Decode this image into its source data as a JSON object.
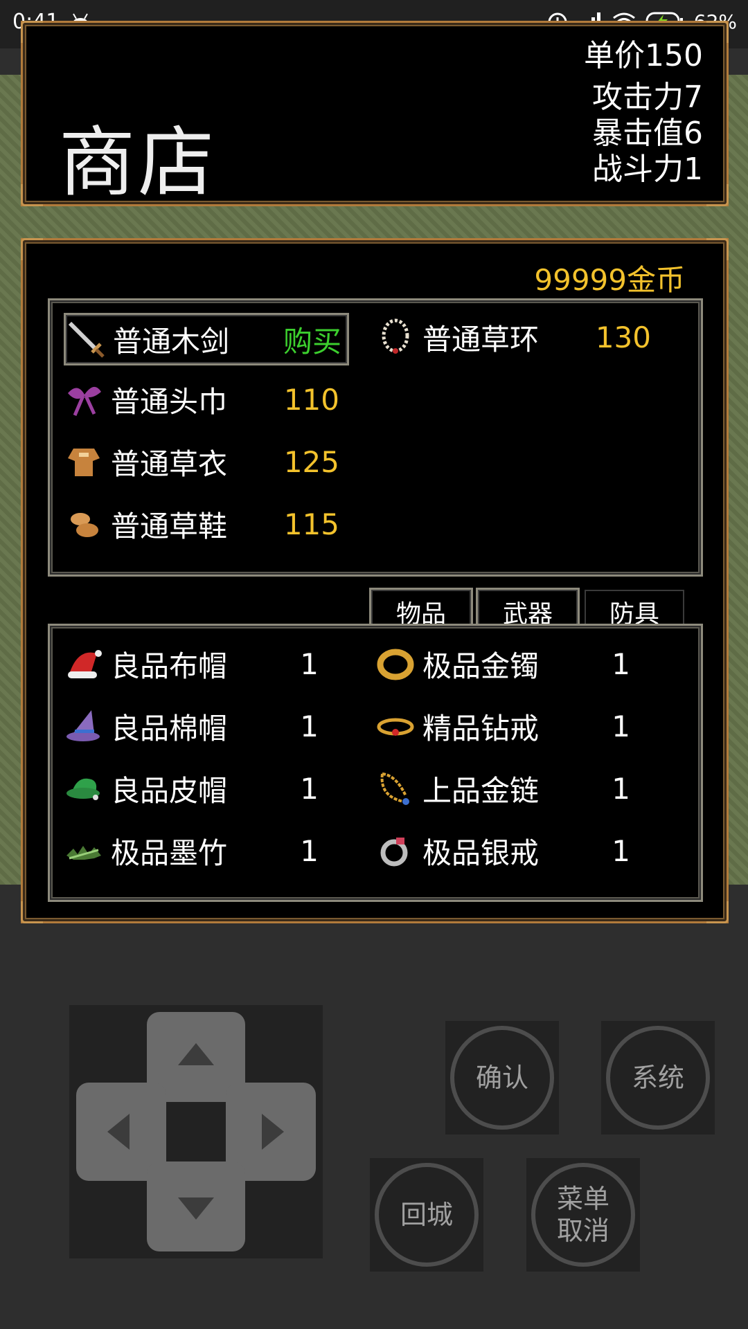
{
  "status_bar": {
    "time": "0:41",
    "battery": "62%"
  },
  "header": {
    "title": "商店",
    "unit_price": "单价150",
    "attack": "攻击力7",
    "crit": "暴击值6",
    "power": "战斗力1"
  },
  "gold": "99999金币",
  "shop_items": [
    {
      "name": "普通木剑",
      "price": "购买",
      "icon": "sword-icon",
      "buy": true
    },
    {
      "name": "普通草环",
      "price": "130",
      "icon": "necklace-icon"
    },
    {
      "name": "普通头巾",
      "price": "110",
      "icon": "ribbon-icon"
    },
    {
      "name": "普通草衣",
      "price": "125",
      "icon": "armor-icon"
    },
    {
      "name": "普通草鞋",
      "price": "115",
      "icon": "shoes-icon"
    }
  ],
  "tabs": [
    "物品",
    "武器",
    "防具"
  ],
  "inventory": [
    {
      "name": "良品布帽",
      "count": "1",
      "icon": "santa-hat-icon"
    },
    {
      "name": "极品金镯",
      "count": "1",
      "icon": "gold-bracelet-icon"
    },
    {
      "name": "良品棉帽",
      "count": "1",
      "icon": "wizard-hat-icon"
    },
    {
      "name": "精品钻戒",
      "count": "1",
      "icon": "diamond-ring-icon"
    },
    {
      "name": "良品皮帽",
      "count": "1",
      "icon": "leather-hat-icon"
    },
    {
      "name": "上品金链",
      "count": "1",
      "icon": "gold-chain-icon"
    },
    {
      "name": "极品墨竹",
      "count": "1",
      "icon": "bamboo-icon"
    },
    {
      "name": "极品银戒",
      "count": "1",
      "icon": "silver-ring-icon"
    }
  ],
  "controls": {
    "confirm": "确认",
    "system": "系统",
    "return_city": "回城",
    "menu_cancel_1": "菜单",
    "menu_cancel_2": "取消"
  },
  "colors": {
    "gold": "#f3c22c",
    "buy": "#3ccf2e",
    "frame": "#b27b3b"
  }
}
